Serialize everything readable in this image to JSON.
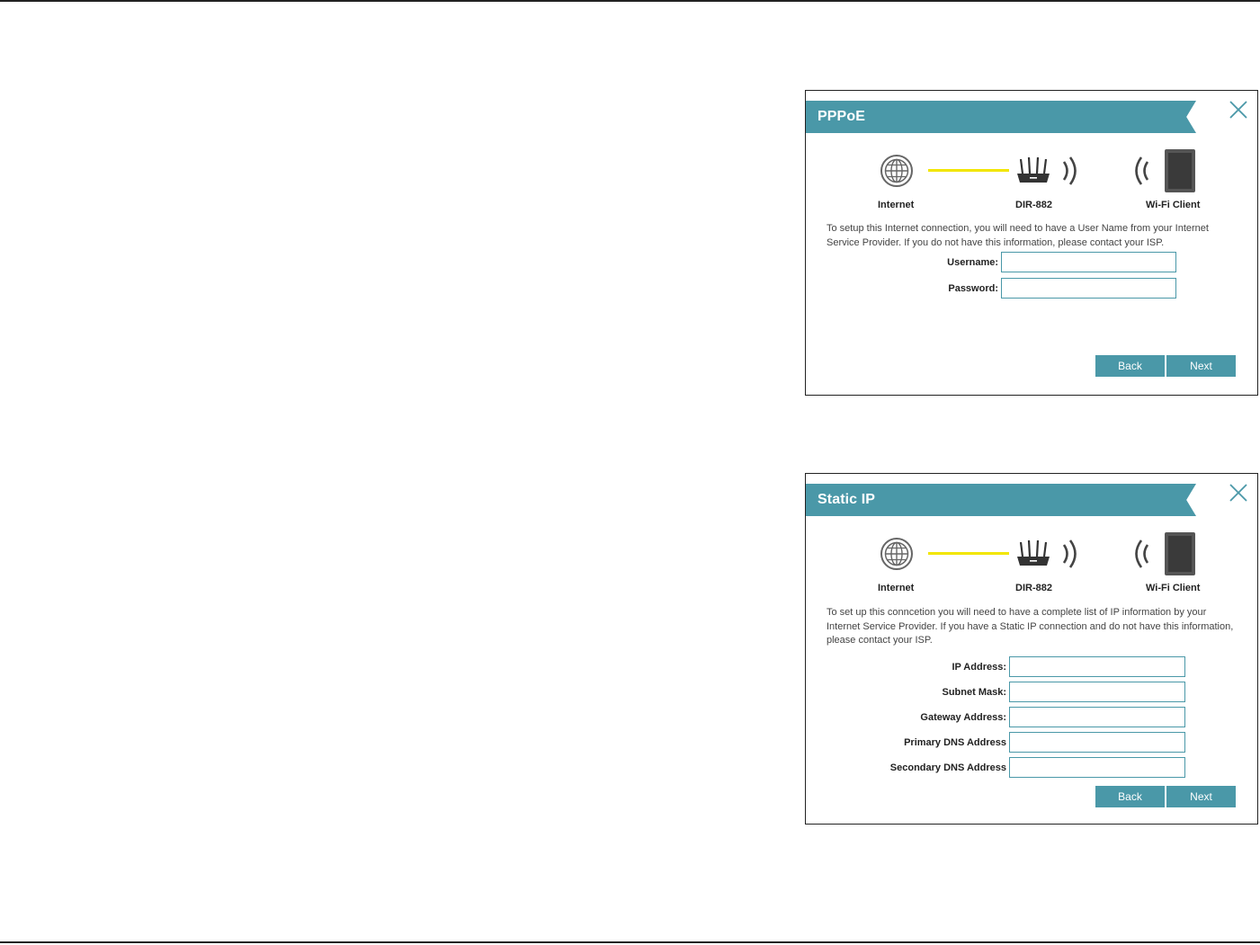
{
  "diagram": {
    "internet_label": "Internet",
    "router_label": "DIR-882",
    "client_label": "Wi-Fi Client",
    "line_color": "#f2e600",
    "icons": [
      "globe-icon",
      "router-icon",
      "wifi-signal-icon",
      "tablet-icon"
    ]
  },
  "pppoe": {
    "title": "PPPoE",
    "description": "To setup this Internet connection, you will need to have a User Name from your Internet Service Provider. If you do not have this information, please contact your ISP.",
    "fields": [
      {
        "label": "Username:",
        "value": ""
      },
      {
        "label": "Password:",
        "value": ""
      }
    ],
    "back_label": "Back",
    "next_label": "Next"
  },
  "static_ip": {
    "title": "Static IP",
    "description": "To set up this conncetion you will need to have a complete list of IP information by your Internet Service Provider. If you have a Static IP connection and do not have this information, please contact your ISP.",
    "fields": [
      {
        "label": "IP Address:",
        "value": ""
      },
      {
        "label": "Subnet Mask:",
        "value": ""
      },
      {
        "label": "Gateway Address:",
        "value": ""
      },
      {
        "label": "Primary DNS Address",
        "value": ""
      },
      {
        "label": "Secondary DNS Address",
        "value": ""
      }
    ],
    "back_label": "Back",
    "next_label": "Next"
  },
  "colors": {
    "accent": "#4a98a8",
    "connection_line": "#f2e600"
  }
}
